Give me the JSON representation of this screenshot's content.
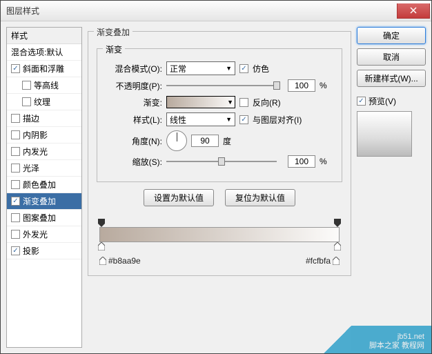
{
  "window": {
    "title": "图层样式"
  },
  "sidebar": {
    "header": "样式",
    "blend_options": "混合选项:默认",
    "items": [
      {
        "label": "斜面和浮雕",
        "checked": true
      },
      {
        "label": "等高线",
        "checked": false,
        "sub": true
      },
      {
        "label": "纹理",
        "checked": false,
        "sub": true
      },
      {
        "label": "描边",
        "checked": false
      },
      {
        "label": "内阴影",
        "checked": false
      },
      {
        "label": "内发光",
        "checked": false
      },
      {
        "label": "光泽",
        "checked": false
      },
      {
        "label": "颜色叠加",
        "checked": false
      },
      {
        "label": "渐变叠加",
        "checked": true,
        "selected": true
      },
      {
        "label": "图案叠加",
        "checked": false
      },
      {
        "label": "外发光",
        "checked": false
      },
      {
        "label": "投影",
        "checked": true
      }
    ]
  },
  "panel": {
    "title": "渐变叠加",
    "group": "渐变",
    "blend_mode_label": "混合模式(O):",
    "blend_mode_value": "正常",
    "dither_label": "仿色",
    "dither_checked": true,
    "opacity_label": "不透明度(P):",
    "opacity_value": "100",
    "opacity_unit": "%",
    "gradient_label": "渐变:",
    "reverse_label": "反向(R)",
    "reverse_checked": false,
    "style_label": "样式(L):",
    "style_value": "线性",
    "align_label": "与图层对齐(I)",
    "align_checked": true,
    "angle_label": "角度(N):",
    "angle_value": "90",
    "angle_unit": "度",
    "scale_label": "缩放(S):",
    "scale_value": "100",
    "scale_unit": "%",
    "set_default": "设置为默认值",
    "reset_default": "复位为默认值"
  },
  "gradient": {
    "left_color": "#b8aa9e",
    "right_color": "#fcfbfa"
  },
  "buttons": {
    "ok": "确定",
    "cancel": "取消",
    "new_style": "新建样式(W)...",
    "preview_label": "预览(V)",
    "preview_checked": true
  },
  "watermark": {
    "line1": "jb51.net",
    "line2": "脚本之家 教程网"
  }
}
